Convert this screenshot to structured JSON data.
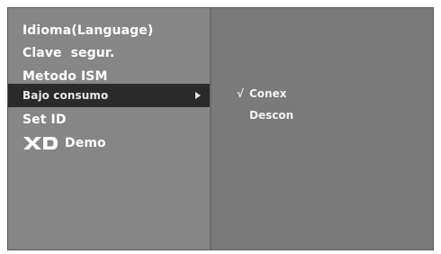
{
  "menu": {
    "items": [
      {
        "label": "Idioma(Language)"
      },
      {
        "label": "Clave  segur."
      },
      {
        "label": "Metodo ISM"
      },
      {
        "label": "Bajo consumo"
      },
      {
        "label": "Set ID"
      },
      {
        "label": "Demo",
        "logo": "XD"
      }
    ],
    "selected": "Bajo consumo",
    "arrow_icon": "triangle-right-icon"
  },
  "submenu": {
    "check_icon": "√",
    "options": [
      {
        "label": "Conex"
      },
      {
        "label": "Descon"
      }
    ]
  }
}
